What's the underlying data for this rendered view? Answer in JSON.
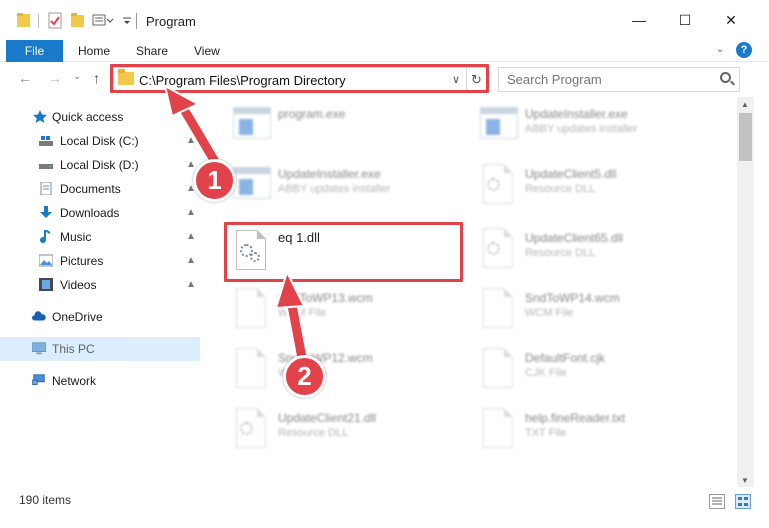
{
  "window": {
    "title": "Program",
    "minimize": "—",
    "maximize": "☐",
    "close": "✕"
  },
  "ribbon": {
    "file": "File",
    "tabs": [
      "Home",
      "Share",
      "View"
    ],
    "help": "?"
  },
  "nav": {
    "back": "←",
    "forward": "→",
    "dropdown": "⌄",
    "up": "↑",
    "address": "C:\\Program Files\\Program Directory",
    "address_dropdown": "∨",
    "refresh": "↻",
    "search_placeholder": "Search Program"
  },
  "sidebar": {
    "quick_access": "Quick access",
    "items": [
      {
        "label": "Local Disk (C:)",
        "icon": "drive-icon"
      },
      {
        "label": "Local Disk (D:)",
        "icon": "drive-icon"
      },
      {
        "label": "Documents",
        "icon": "documents-icon"
      },
      {
        "label": "Downloads",
        "icon": "downloads-icon"
      },
      {
        "label": "Music",
        "icon": "music-icon"
      },
      {
        "label": "Pictures",
        "icon": "pictures-icon"
      },
      {
        "label": "Videos",
        "icon": "videos-icon"
      }
    ],
    "onedrive": "OneDrive",
    "this_pc": "This PC",
    "network": "Network",
    "pin": "📌"
  },
  "files": {
    "left": [
      {
        "name": "program.exe",
        "type": ""
      },
      {
        "name": "UpdateInstaller.exe",
        "type": "ABBY updates installer"
      },
      {
        "name": "eq 1.dll",
        "type": ""
      },
      {
        "name": "SndToWP13.wcm",
        "type": "WCM File"
      },
      {
        "name": "SndToWP12.wcm",
        "type": "WCM File"
      },
      {
        "name": "UpdateClient21.dll",
        "type": "Resource DLL"
      }
    ],
    "right": [
      {
        "name": "UpdateInstaller.exe",
        "type": "ABBY updates installer"
      },
      {
        "name": "UpdateClient5.dll",
        "type": "Resource DLL"
      },
      {
        "name": "UpdateClient65.dll",
        "type": "Resource DLL"
      },
      {
        "name": "SndToWP14.wcm",
        "type": "WCM File"
      },
      {
        "name": "DefaultFont.cjk",
        "type": "CJK File"
      },
      {
        "name": "help.fineReader.txt",
        "type": "TXT File"
      }
    ]
  },
  "status": {
    "item_count": "190 items"
  },
  "callouts": [
    "1",
    "2"
  ],
  "colors": {
    "accent": "#1979ca",
    "highlight": "#e2424a",
    "folder": "#f3c94b",
    "selected": "#cce8ff"
  }
}
